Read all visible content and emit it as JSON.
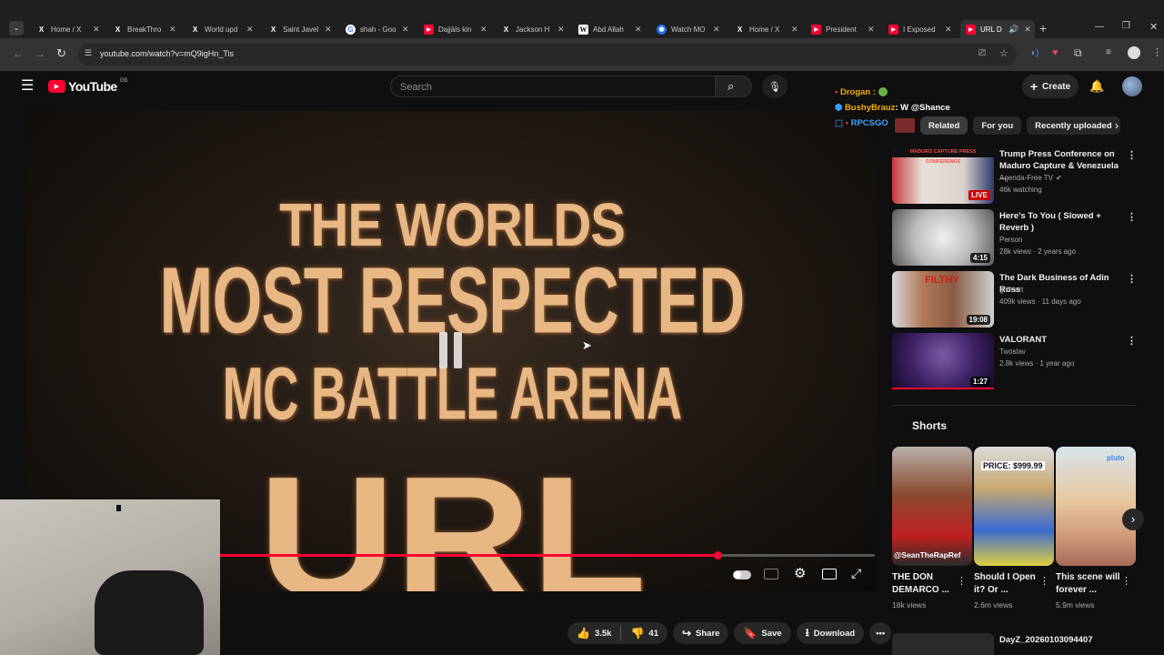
{
  "browser": {
    "tabs": [
      {
        "title": "Home / X",
        "favicon": "x-icon"
      },
      {
        "title": "BreakThro",
        "favicon": "x-icon"
      },
      {
        "title": "World upd",
        "favicon": "x-icon"
      },
      {
        "title": "Saint Javel",
        "favicon": "x-icon"
      },
      {
        "title": "shah - Goo",
        "favicon": "google-icon"
      },
      {
        "title": "Dajjāls kin",
        "favicon": "youtube-icon"
      },
      {
        "title": "Jackson H",
        "favicon": "x-icon"
      },
      {
        "title": "Abd Allah",
        "favicon": "wikipedia-icon"
      },
      {
        "title": "Watch MO",
        "favicon": "globe-icon"
      },
      {
        "title": "Home / X",
        "favicon": "x-icon"
      },
      {
        "title": "President",
        "favicon": "youtube-icon"
      },
      {
        "title": "I Exposed",
        "favicon": "youtube-icon"
      },
      {
        "title": "URL D",
        "favicon": "youtube-icon",
        "active": true
      }
    ],
    "url": "youtube.com/watch?v=mQ9igHn_Tis"
  },
  "header": {
    "logo_text": "YouTube",
    "region": "GB",
    "search_placeholder": "Search",
    "create_label": "Create"
  },
  "video": {
    "overlay_line1": "THE WORLDS",
    "overlay_line2": "MOST RESPECTED",
    "overlay_line3": "MC BATTLE ARENA",
    "overlay_line4": "URL",
    "progress": 0.76
  },
  "chat_overlay": [
    {
      "user": "Drogan :",
      "msg": ""
    },
    {
      "user": "BushyBrauz",
      "msg": ": W @Shance"
    },
    {
      "user": "RPCSGO",
      "msg": ""
    }
  ],
  "chips": [
    "Related",
    "For you",
    "Recently uploaded"
  ],
  "related": [
    {
      "title": "Trump Press Conference on Maduro Capture & Venezuela ...",
      "channel": "Agenda-Free TV",
      "meta": "46k watching",
      "badge": "LIVE",
      "thumb_label": "MADURO CAPTURE PRESS CONFERENCE"
    },
    {
      "title": "Here's To You ( Slowed + Reverb )",
      "channel": "Person",
      "meta": "28k views · 2 years ago",
      "badge": "4:15"
    },
    {
      "title": "The Dark Business of Adin Ross",
      "channel": "golfcart",
      "meta": "409k views · 11 days ago",
      "badge": "19:08",
      "thumb_label": "FILTHY"
    },
    {
      "title": "VALORANT",
      "channel": "Twoslav",
      "meta": "2.8k views · 1 year ago",
      "badge": "1:27"
    }
  ],
  "shorts": {
    "heading": "Shorts",
    "items": [
      {
        "title": "THE DON DEMARCO ...",
        "views": "18k views",
        "thumb_label": "@SeanTheRapRef"
      },
      {
        "title": "Should I Open it? Or ...",
        "views": "2.6m views",
        "thumb_label": "PRICE: $999.99"
      },
      {
        "title": "This scene will forever ...",
        "views": "5.9m views",
        "thumb_label": ""
      }
    ]
  },
  "next_item_title": "DayZ_20260103094407",
  "actions": {
    "likes": "3.5k",
    "dislikes": "41",
    "share": "Share",
    "save": "Save",
    "download": "Download"
  },
  "colors": {
    "accent_red": "#ff0033",
    "background": "#0f0f0f"
  }
}
